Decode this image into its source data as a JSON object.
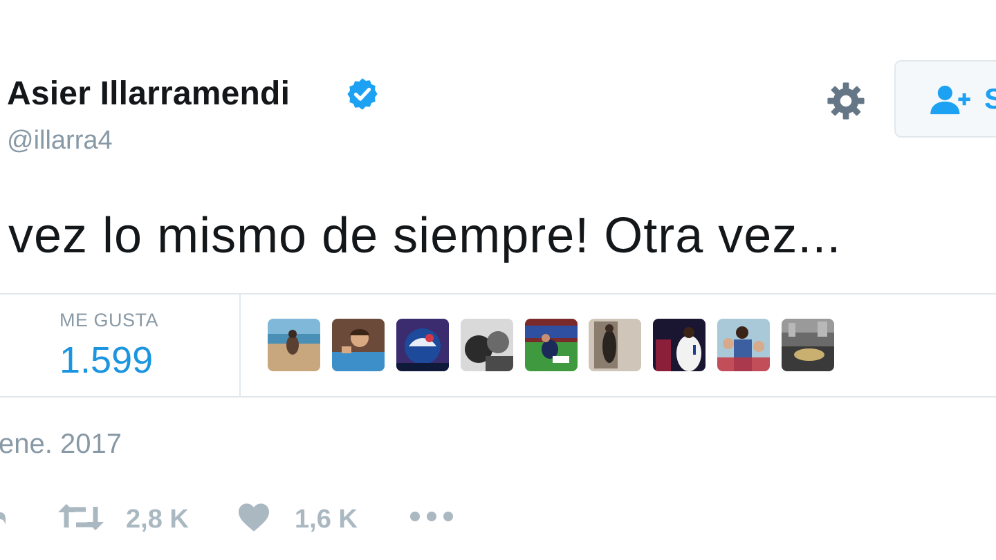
{
  "tweet": {
    "author_name": "Asier Illarramendi",
    "handle": "@illarra4",
    "text": "vez lo mismo de siempre! Otra vez...",
    "timestamp": "ene. 2017"
  },
  "header": {
    "settings_icon": "gear-icon",
    "verified_icon": "verified-badge-icon",
    "follow_button_label": "S",
    "follow_icon": "add-user-icon"
  },
  "stats": {
    "likes_label": "ME GUSTA",
    "likes_count": "1.599",
    "liker_avatars": [
      "avatar-beach",
      "avatar-football-player",
      "avatar-blue-graphic",
      "avatar-bw-photo",
      "avatar-pitch-player",
      "avatar-mirror-selfie",
      "avatar-white-kit",
      "avatar-group-photo",
      "avatar-street"
    ]
  },
  "actions": {
    "retweet_count": "2,8 K",
    "like_count": "1,6 K",
    "more_icon": "more-dots-icon"
  },
  "colors": {
    "text": "#14171a",
    "muted": "#8899a6",
    "accent": "#1da1f2",
    "likes_count": "#1b95e0",
    "action_gray": "#aab8c2",
    "border": "#e1e8ed"
  }
}
